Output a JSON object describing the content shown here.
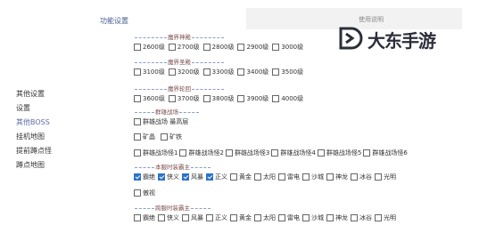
{
  "header": {
    "title": "功能设置",
    "search_placeholder": "使用说明"
  },
  "watermark": {
    "text": "大东手游"
  },
  "sidebar": {
    "items": [
      {
        "label": "其他设置",
        "active": false
      },
      {
        "label": "设置",
        "active": false
      },
      {
        "label": "其他BOSS",
        "active": true
      },
      {
        "label": "挂机地图",
        "active": false
      },
      {
        "label": "提前蹲点怪",
        "active": false
      },
      {
        "label": "蹲点地图",
        "active": false
      }
    ]
  },
  "sections": {
    "s1": {
      "title": "魔界神殿",
      "options": [
        {
          "label": "2600级",
          "checked": false
        },
        {
          "label": "2700级",
          "checked": false
        },
        {
          "label": "2800级",
          "checked": false
        },
        {
          "label": "2900级",
          "checked": false
        },
        {
          "label": "3000级",
          "checked": false
        }
      ]
    },
    "s2": {
      "title": "魔界圣殿",
      "options": [
        {
          "label": "3100级",
          "checked": false
        },
        {
          "label": "3200级",
          "checked": false
        },
        {
          "label": "3300级",
          "checked": false
        },
        {
          "label": "3400级",
          "checked": false
        },
        {
          "label": "3500级",
          "checked": false
        }
      ]
    },
    "s3": {
      "title": "魔界轮回",
      "options": [
        {
          "label": "3600级",
          "checked": false
        },
        {
          "label": "3700级",
          "checked": false
        },
        {
          "label": "3800级",
          "checked": false
        },
        {
          "label": "3900级",
          "checked": false
        },
        {
          "label": "4000级",
          "checked": false
        }
      ]
    },
    "s4": {
      "title": "群雄战场",
      "row1": [
        {
          "label": "群雄战场 最高层",
          "checked": false
        }
      ],
      "row2": [
        {
          "label": "矿晶",
          "checked": false
        },
        {
          "label": "矿铁",
          "checked": false
        }
      ],
      "row3": [
        {
          "label": "群雄战场怪1",
          "checked": false
        },
        {
          "label": "群雄战场怪2",
          "checked": false
        },
        {
          "label": "群雄战场怪3",
          "checked": false
        },
        {
          "label": "群雄战场怪4",
          "checked": false
        },
        {
          "label": "群雄战场怪5",
          "checked": false
        },
        {
          "label": "群雄战场怪6",
          "checked": false
        }
      ]
    },
    "s5": {
      "title": "本服时装霸主",
      "row1": [
        {
          "label": "霸绝",
          "checked": true
        },
        {
          "label": "侠义",
          "checked": true
        },
        {
          "label": "风暴",
          "checked": true
        },
        {
          "label": "正义",
          "checked": true
        },
        {
          "label": "黄金",
          "checked": false
        },
        {
          "label": "太阳",
          "checked": false
        },
        {
          "label": "雷电",
          "checked": false
        },
        {
          "label": "沙城",
          "checked": false
        },
        {
          "label": "神龙",
          "checked": false
        },
        {
          "label": "冰谷",
          "checked": false
        },
        {
          "label": "光明",
          "checked": false
        }
      ],
      "row2": [
        {
          "label": "傲视",
          "checked": false
        }
      ]
    },
    "s6": {
      "title": "跨服时装霸主",
      "row1": [
        {
          "label": "霸绝",
          "checked": false
        },
        {
          "label": "侠义",
          "checked": false
        },
        {
          "label": "风暴",
          "checked": false
        },
        {
          "label": "正义",
          "checked": false
        },
        {
          "label": "黄金",
          "checked": false
        },
        {
          "label": "太阳",
          "checked": false
        },
        {
          "label": "雷电",
          "checked": false
        },
        {
          "label": "沙城",
          "checked": false
        },
        {
          "label": "神龙",
          "checked": false
        },
        {
          "label": "冰谷",
          "checked": false
        },
        {
          "label": "光明",
          "checked": false
        }
      ]
    }
  }
}
